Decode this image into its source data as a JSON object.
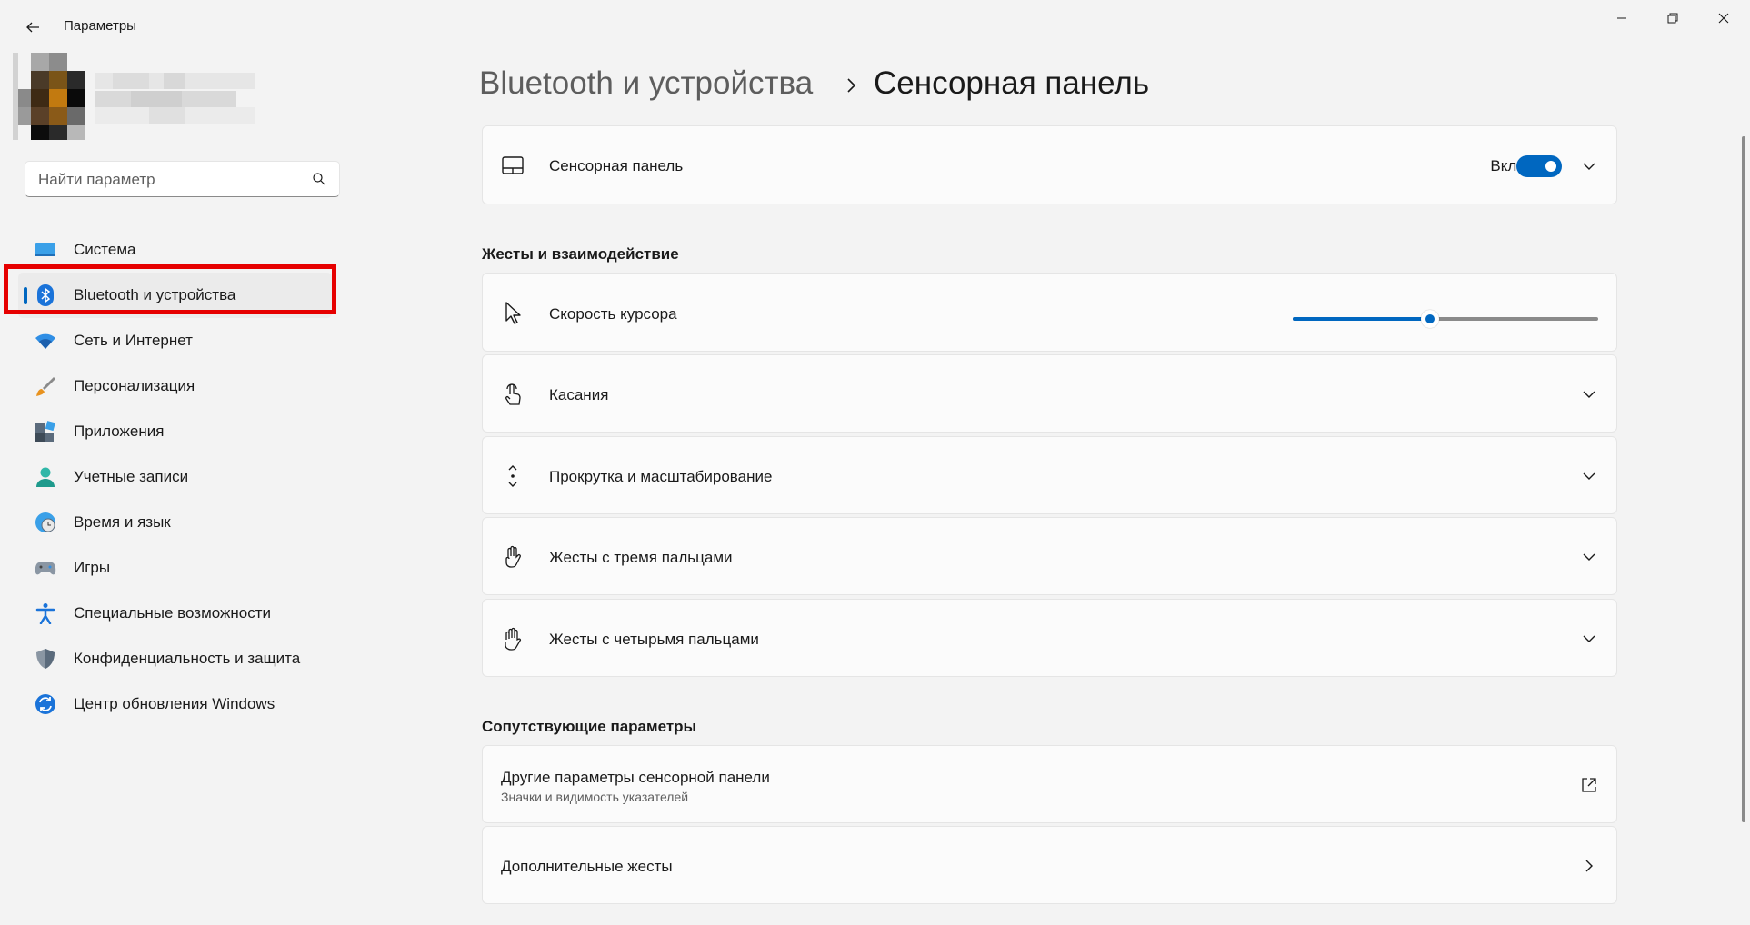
{
  "window": {
    "title": "Параметры",
    "back_icon": "arrow-left-icon",
    "minimize_icon": "minimize-icon",
    "restore_icon": "restore-icon",
    "close_icon": "close-icon"
  },
  "search": {
    "placeholder": "Найти параметр",
    "value": "",
    "icon": "search-icon"
  },
  "sidebar": {
    "items": [
      {
        "label": "Система",
        "icon": "system-icon",
        "active": false
      },
      {
        "label": "Bluetooth и устройства",
        "icon": "bluetooth-icon",
        "active": true
      },
      {
        "label": "Сеть и Интернет",
        "icon": "wifi-icon",
        "active": false
      },
      {
        "label": "Персонализация",
        "icon": "brush-icon",
        "active": false
      },
      {
        "label": "Приложения",
        "icon": "apps-icon",
        "active": false
      },
      {
        "label": "Учетные записи",
        "icon": "account-icon",
        "active": false
      },
      {
        "label": "Время и язык",
        "icon": "globe-clock-icon",
        "active": false
      },
      {
        "label": "Игры",
        "icon": "gamepad-icon",
        "active": false
      },
      {
        "label": "Специальные возможности",
        "icon": "accessibility-icon",
        "active": false
      },
      {
        "label": "Конфиденциальность и защита",
        "icon": "shield-icon",
        "active": false
      },
      {
        "label": "Центр обновления Windows",
        "icon": "update-icon",
        "active": false
      }
    ]
  },
  "breadcrumb": {
    "parent": "Bluetooth и устройства",
    "separator_icon": "chevron-right-icon",
    "current": "Сенсорная панель"
  },
  "touchpad_card": {
    "label": "Сенсорная панель",
    "icon": "touchpad-icon",
    "toggle_label": "Вкл.",
    "toggle_on": true
  },
  "gestures_section": {
    "title": "Жесты и взаимодействие",
    "cursor_speed": {
      "label": "Скорость курсора",
      "icon": "cursor-icon",
      "value_fraction": 0.45
    },
    "items": [
      {
        "label": "Касания",
        "icon": "tap-icon"
      },
      {
        "label": "Прокрутка и масштабирование",
        "icon": "scroll-zoom-icon"
      },
      {
        "label": "Жесты с тремя пальцами",
        "icon": "three-finger-icon"
      },
      {
        "label": "Жесты с четырьмя пальцами",
        "icon": "four-finger-icon"
      }
    ]
  },
  "related_section": {
    "title": "Сопутствующие параметры",
    "items": [
      {
        "label": "Другие параметры сенсорной панели",
        "sublabel": "Значки и видимость указателей",
        "icon": "external-link-icon"
      },
      {
        "label": "Дополнительные жесты",
        "sublabel": "",
        "icon": "chevron-right-icon"
      }
    ]
  },
  "colors": {
    "accent": "#0067c0",
    "highlight": "#e60000"
  }
}
